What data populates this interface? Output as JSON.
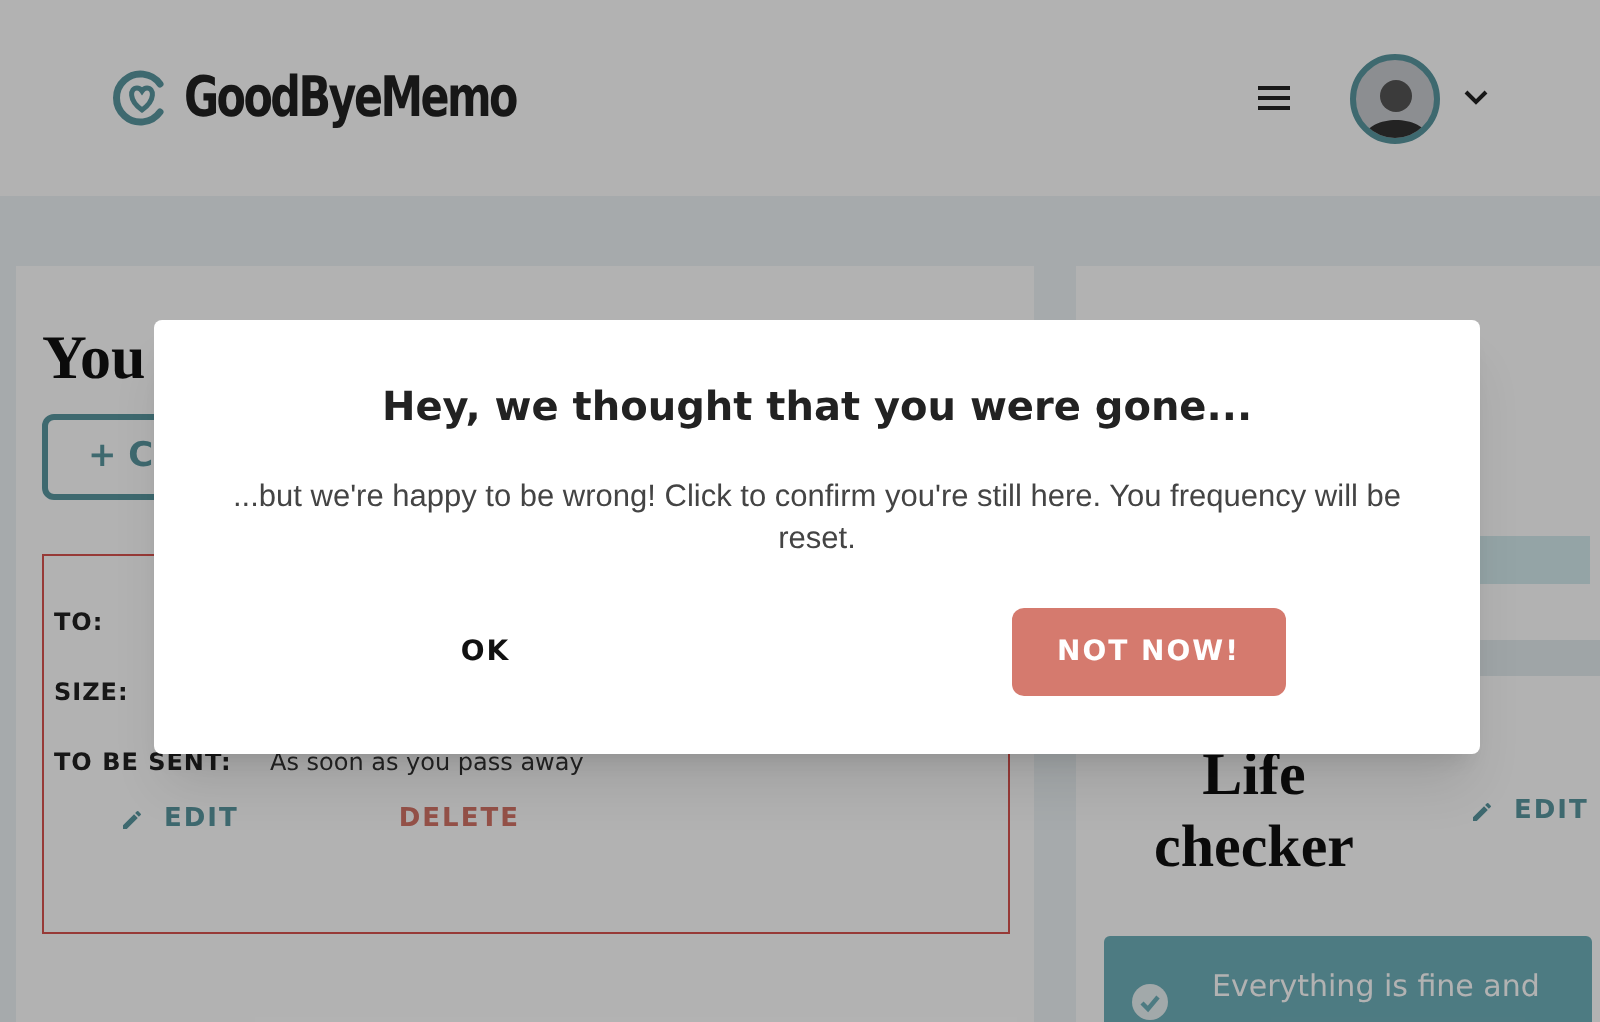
{
  "header": {
    "logo_text": "GoodByeMemo"
  },
  "messages_panel": {
    "heading": "You",
    "create_button": "+ C",
    "record": {
      "fields": [
        {
          "label": "TO:"
        },
        {
          "label": "SIZE:"
        },
        {
          "label": "TO BE SENT:",
          "value": "As soon as you pass away"
        }
      ],
      "edit_button": "EDIT",
      "delete_button": "DELETE"
    }
  },
  "life_checker": {
    "title": "Life checker",
    "edit_button": "EDIT",
    "status": "Everything is fine and"
  },
  "dialog": {
    "title": "Hey, we thought that you were gone...",
    "message": "...but we're happy to be wrong! Click to confirm you're still here. You frequency will be reset.",
    "buttons": [
      {
        "label": "OK",
        "kind": "plain"
      },
      {
        "label": "NOT NOW!",
        "kind": "primary"
      }
    ]
  }
}
